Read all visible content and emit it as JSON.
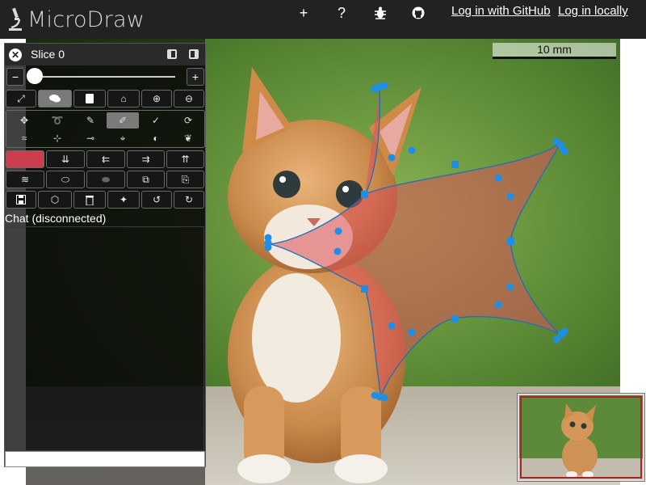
{
  "app": {
    "title": "MicroDraw"
  },
  "topbar": {
    "icons": [
      {
        "name": "add-icon",
        "glyph": "+"
      },
      {
        "name": "help-icon",
        "glyph": "?"
      },
      {
        "name": "bug-icon",
        "glyph": "☀"
      },
      {
        "name": "github-icon",
        "glyph": "◉"
      }
    ],
    "login_github": "Log in with GitHub",
    "login_local": "Log in locally"
  },
  "panel": {
    "slice_label": "Slice 0",
    "close_glyph": "✕",
    "zoom_minus": "−",
    "zoom_plus": "+",
    "zoom_level": 0,
    "chat_label": "Chat (disconnected)",
    "chat_input_value": "",
    "annotation_color": "#cc3d4f"
  },
  "toolbar": {
    "view_tools": [
      {
        "name": "fullscreen-icon",
        "glyph": "⤢"
      },
      {
        "name": "chat-icon",
        "glyph": "💬",
        "selected": true
      },
      {
        "name": "script-icon",
        "glyph": "📜"
      },
      {
        "name": "home-icon",
        "glyph": "⌂"
      },
      {
        "name": "zoom-in-icon",
        "glyph": "⊕"
      },
      {
        "name": "zoom-out-icon",
        "glyph": "⊖"
      }
    ],
    "draw_tools_row1": [
      {
        "name": "move-icon",
        "glyph": "✥"
      },
      {
        "name": "lasso-icon",
        "glyph": "➰"
      },
      {
        "name": "draw-icon",
        "glyph": "✎"
      },
      {
        "name": "select-icon",
        "glyph": "✐",
        "selected": true
      },
      {
        "name": "pen-icon",
        "glyph": "✓"
      },
      {
        "name": "rotate-icon",
        "glyph": "⟳"
      }
    ],
    "draw_tools_row2": [
      {
        "name": "simplify-icon",
        "glyph": "≈"
      },
      {
        "name": "add-point-icon",
        "glyph": "⊹"
      },
      {
        "name": "delete-point-icon",
        "glyph": "⊸"
      },
      {
        "name": "split-icon",
        "glyph": "⌖"
      },
      {
        "name": "fill-icon",
        "glyph": "◐"
      },
      {
        "name": "leaf-icon",
        "glyph": "❦"
      }
    ],
    "order_tools": [
      {
        "name": "color-swatch",
        "glyph": ""
      },
      {
        "name": "bring-to-front-icon",
        "glyph": "⇊"
      },
      {
        "name": "send-backward-icon",
        "glyph": "⇇"
      },
      {
        "name": "bring-forward-icon",
        "glyph": "⇉"
      },
      {
        "name": "send-to-back-icon",
        "glyph": "⇈"
      }
    ],
    "edit_tools": [
      {
        "name": "smooth-icon",
        "glyph": "≋"
      },
      {
        "name": "union-icon",
        "glyph": "⬭"
      },
      {
        "name": "intersect-icon",
        "glyph": "⬬"
      },
      {
        "name": "copy-icon",
        "glyph": "⧉"
      },
      {
        "name": "paste-icon",
        "glyph": "⎘"
      }
    ],
    "file_tools": [
      {
        "name": "save-icon",
        "glyph": "💾"
      },
      {
        "name": "screenshot-icon",
        "glyph": "⬡"
      },
      {
        "name": "trash-icon",
        "glyph": "🗑"
      },
      {
        "name": "magic-wand-icon",
        "glyph": "✦"
      },
      {
        "name": "undo-icon",
        "glyph": "↺"
      },
      {
        "name": "redo-icon",
        "glyph": "↻"
      }
    ]
  },
  "viewer": {
    "scale_bar": "10 mm"
  }
}
